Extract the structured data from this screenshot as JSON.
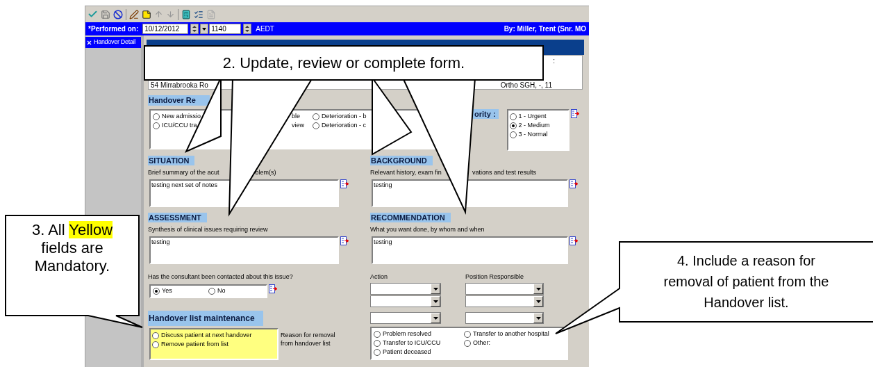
{
  "header_bar": {
    "performed_label": "*Performed on:",
    "date": "10/12/2012",
    "time": "1140",
    "timezone": "AEDT",
    "by": "By:  Miller, Trent (Snr. MO"
  },
  "nav": [
    {
      "label": "Handover Detail",
      "selected": true
    }
  ],
  "patient": {
    "label_fragment": ":",
    "address": "54 Mirrabrooka Ro",
    "location": "Ortho SGH, -, 11"
  },
  "handover_reason": {
    "heading": "Handover Re",
    "columns": [
      [
        {
          "kind": "radio",
          "label": "New admissio",
          "selected": false
        },
        {
          "kind": "radio",
          "label": "ICU/CCU tra",
          "selected": false
        }
      ],
      [
        {
          "kind": "fragment",
          "label": "ble"
        },
        {
          "kind": "fragment",
          "label": "view"
        }
      ],
      [
        {
          "kind": "radio",
          "label": "Deterioration - b",
          "selected": false
        },
        {
          "kind": "radio",
          "label": "Deterioration - c",
          "selected": false
        }
      ]
    ]
  },
  "priority": {
    "label": "ority :",
    "options": [
      {
        "label": "1 - Urgent",
        "selected": false
      },
      {
        "label": "2 - Medium",
        "selected": true
      },
      {
        "label": "3 - Normal",
        "selected": false
      }
    ]
  },
  "sections": [
    {
      "heading": "SITUATION",
      "description": [
        "Brief summary of the acut",
        "blem(s)"
      ],
      "value": "testing next set of notes"
    },
    {
      "heading": "BACKGROUND",
      "description": [
        "Relevant history, exam fin",
        "vations and test results"
      ],
      "value": "testing"
    },
    {
      "heading": "ASSESSMENT",
      "description": [
        "Synthesis of clinical issues requiring review"
      ],
      "value": "testing"
    },
    {
      "heading": "RECOMMENDATION",
      "description": [
        "What you want done, by whom and when"
      ],
      "value": "testing"
    }
  ],
  "consultant": {
    "question": "Has the consultant been contacted about this issue?",
    "options": [
      {
        "label": "Yes",
        "selected": true
      },
      {
        "label": "No",
        "selected": false
      }
    ]
  },
  "actions": {
    "action_label": "Action",
    "position_label": "Position Responsible",
    "rows": [
      {
        "kind": "dropdown-pair"
      },
      {
        "kind": "dropdown-pair"
      },
      {
        "kind": "dropdown-pair"
      }
    ]
  },
  "maintenance": {
    "heading": "Handover list maintenance",
    "mandatory": true,
    "options": [
      {
        "label": "Discuss patient at next handover",
        "selected": false
      },
      {
        "label": "Remove patient from list",
        "selected": false
      }
    ],
    "reason_label": "Reason for removal from handover list",
    "reasons": [
      {
        "label": "Problem resolved",
        "selected": false
      },
      {
        "label": "Transfer to another hospital",
        "selected": false
      },
      {
        "label": "Transfer to ICU/CCU",
        "selected": false
      },
      {
        "label": "Other:",
        "selected": false
      },
      {
        "label": "Patient deceased",
        "selected": false
      }
    ]
  },
  "callouts": [
    {
      "kind": "form",
      "text": "2. Update, review or complete form."
    },
    {
      "kind": "mandatory",
      "segments": [
        {
          "text": "3. All ",
          "highlighted": false
        },
        {
          "text": "Yellow",
          "highlighted": true
        },
        {
          "text": " fields are Mandatory.",
          "highlighted": false
        }
      ]
    },
    {
      "kind": "removal",
      "text": "4. Include a reason for removal of patient from the Handover list."
    }
  ]
}
